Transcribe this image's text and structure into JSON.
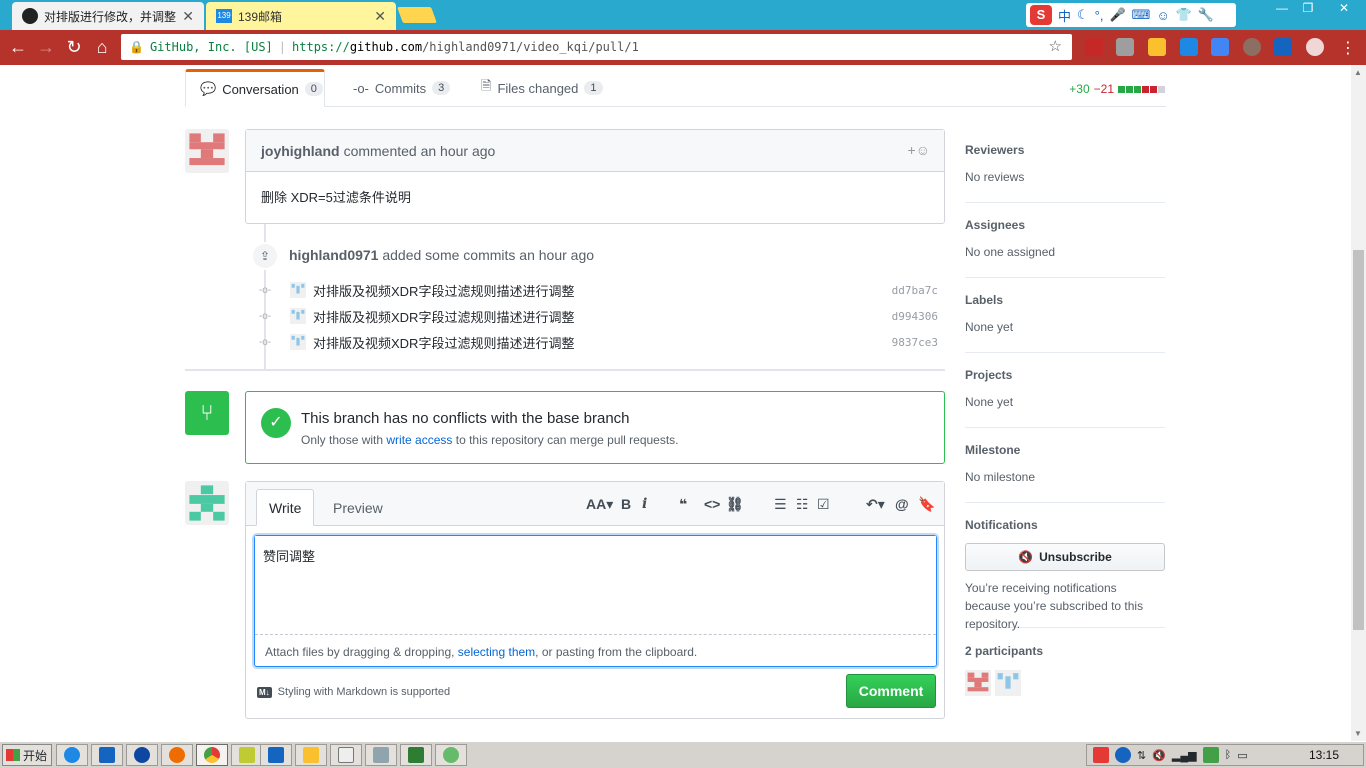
{
  "browser": {
    "tabs": [
      {
        "title": "对排版进行修改，并调整",
        "active": true
      },
      {
        "title": "139邮箱",
        "active": false
      }
    ],
    "ime_label": "中",
    "window_controls": [
      "—",
      "❐",
      "✕"
    ],
    "url": {
      "org": "GitHub, Inc. [US]",
      "scheme": "https://",
      "host": "github.com",
      "path": "/highland0971/video_kqi/pull/1"
    }
  },
  "pr_tabs": {
    "conversation": {
      "label": "Conversation",
      "count": "0"
    },
    "commits": {
      "label": "Commits",
      "count": "3"
    },
    "files": {
      "label": "Files changed",
      "count": "1"
    }
  },
  "diffstat": {
    "additions": "+30",
    "deletions": "−21",
    "blocks": [
      "#28a745",
      "#28a745",
      "#28a745",
      "#cb2431",
      "#cb2431",
      "#d1d5da"
    ]
  },
  "comment": {
    "author": "joyhighland",
    "action": "commented an hour ago",
    "body": "删除 XDR=5过滤条件说明"
  },
  "commits_event": {
    "author": "highland0971",
    "action": "added some commits an hour ago",
    "commits": [
      {
        "message": "对排版及视频XDR字段过滤规则描述进行调整",
        "sha": "dd7ba7c"
      },
      {
        "message": "对排版及视频XDR字段过滤规则描述进行调整",
        "sha": "d994306"
      },
      {
        "message": "对排版及视频XDR字段过滤规则描述进行调整",
        "sha": "9837ce3"
      }
    ]
  },
  "merge": {
    "title": "This branch has no conflicts with the base branch",
    "sub_prefix": "Only those with ",
    "sub_link": "write access",
    "sub_suffix": " to this repository can merge pull requests."
  },
  "new_comment": {
    "tab_write": "Write",
    "tab_preview": "Preview",
    "text": "赞同调整",
    "attach_prefix": "Attach files by dragging & dropping, ",
    "attach_link": "selecting them",
    "attach_suffix": ", or pasting from the clipboard.",
    "markdown_note": "Styling with Markdown is supported",
    "markdown_badge": "M↓",
    "submit": "Comment",
    "toolbar_icons": [
      "text-size-icon",
      "bold-icon",
      "italic-icon",
      "quote-icon",
      "code-icon",
      "link-icon",
      "bulleted-list-icon",
      "numbered-list-icon",
      "task-list-icon",
      "reply-icon",
      "mention-icon",
      "bookmark-icon"
    ]
  },
  "sidebar": {
    "reviewers": {
      "title": "Reviewers",
      "value": "No reviews"
    },
    "assignees": {
      "title": "Assignees",
      "value": "No one assigned"
    },
    "labels": {
      "title": "Labels",
      "value": "None yet"
    },
    "projects": {
      "title": "Projects",
      "value": "None yet"
    },
    "milestone": {
      "title": "Milestone",
      "value": "No milestone"
    },
    "notifications": {
      "title": "Notifications",
      "button": "Unsubscribe",
      "reason": "You’re receiving notifications because you’re subscribed to this repository."
    },
    "participants": {
      "title": "2 participants"
    }
  },
  "taskbar": {
    "start": "开始",
    "clock": "13:15"
  },
  "colors": {
    "chrome_tabbar": "#2aa9cf",
    "chrome_toolbar": "#b5332b",
    "github_green": "#2cbe4e",
    "link_blue": "#0366d6"
  }
}
